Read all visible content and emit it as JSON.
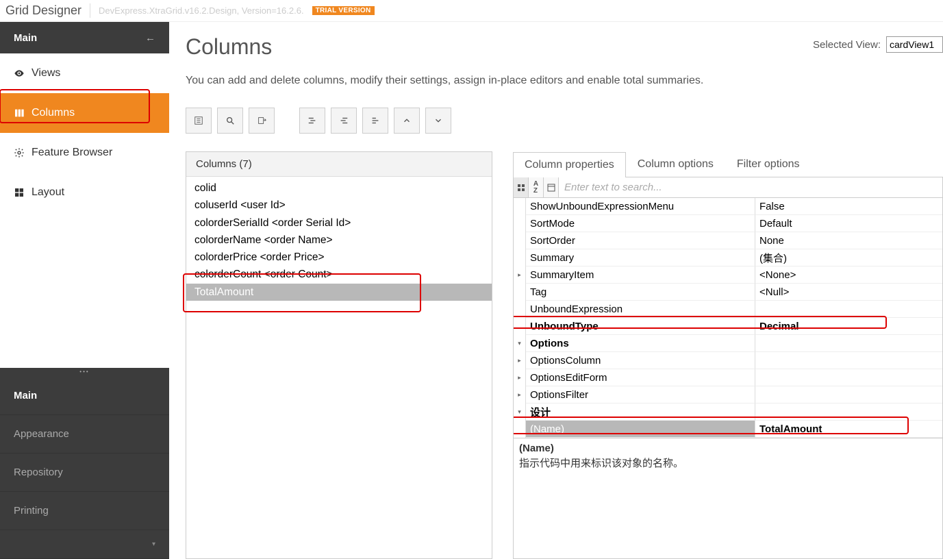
{
  "header": {
    "title": "Grid Designer",
    "version": "DevExpress.XtraGrid.v16.2.Design, Version=16.2.6.",
    "badge": "TRIAL VERSION"
  },
  "sidebar": {
    "head": "Main",
    "items": [
      {
        "label": "Views"
      },
      {
        "label": "Columns"
      },
      {
        "label": "Feature Browser"
      },
      {
        "label": "Layout"
      }
    ],
    "bottom": [
      {
        "label": "Main"
      },
      {
        "label": "Appearance"
      },
      {
        "label": "Repository"
      },
      {
        "label": "Printing"
      },
      {
        "label": ""
      }
    ]
  },
  "main": {
    "title": "Columns",
    "subtitle": "You can add and delete columns, modify their settings, assign in-place editors and enable total summaries.",
    "selected_view_label": "Selected View:",
    "selected_view_value": "cardView1"
  },
  "columns": {
    "header": "Columns (7)",
    "items": [
      "colid",
      "coluserId <user Id>",
      "colorderSerialId <order Serial Id>",
      "colorderName <order Name>",
      "colorderPrice <order Price>",
      "colorderCount <order Count>",
      "TotalAmount"
    ]
  },
  "proptabs": {
    "t0": "Column properties",
    "t1": "Column options",
    "t2": "Filter options"
  },
  "search_placeholder": "Enter text to search...",
  "props": [
    {
      "name": "ShowUnboundExpressionMenu",
      "value": "False"
    },
    {
      "name": "SortMode",
      "value": "Default"
    },
    {
      "name": "SortOrder",
      "value": "None"
    },
    {
      "name": "Summary",
      "value": "(集合)"
    },
    {
      "name": "SummaryItem",
      "value": "<None>",
      "expand": true
    },
    {
      "name": "Tag",
      "value": "<Null>"
    },
    {
      "name": "UnboundExpression",
      "value": ""
    },
    {
      "name": "UnboundType",
      "value": "Decimal",
      "bold": true
    },
    {
      "name": "Options",
      "value": "",
      "cat": true,
      "open": true
    },
    {
      "name": "OptionsColumn",
      "value": "",
      "expand": true
    },
    {
      "name": "OptionsEditForm",
      "value": "",
      "expand": true
    },
    {
      "name": "OptionsFilter",
      "value": "",
      "expand": true
    },
    {
      "name": "设计",
      "value": "",
      "cat": true,
      "open": true
    },
    {
      "name": "(Name)",
      "value": "TotalAmount",
      "sel": true,
      "indent": true
    }
  ],
  "desc": {
    "name": "(Name)",
    "text": "指示代码中用来标识该对象的名称。"
  }
}
